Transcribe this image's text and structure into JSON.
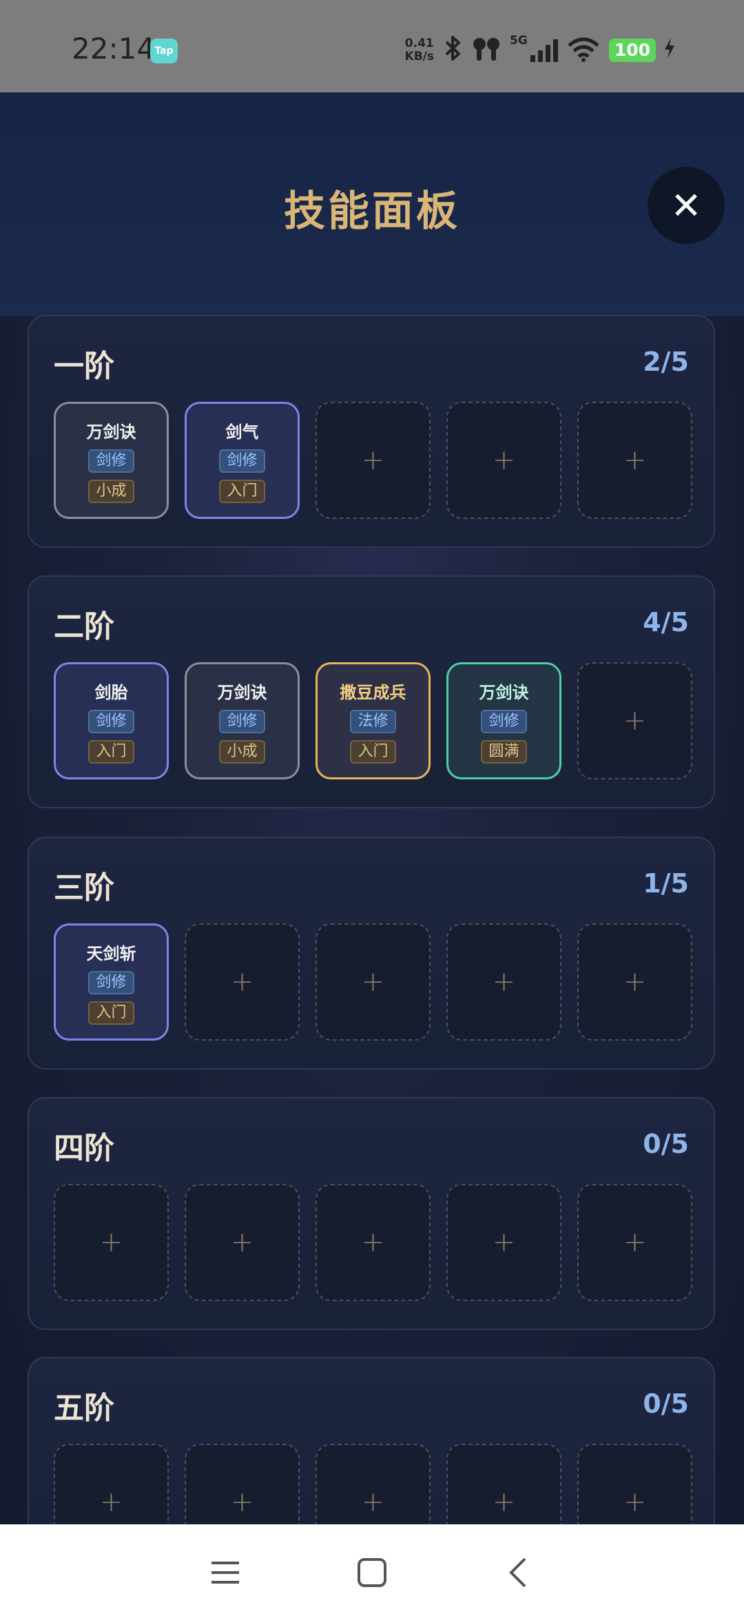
{
  "status_bar": {
    "time": "22:14",
    "tap_label": "Tap",
    "net_speed_value": "0.41",
    "net_speed_unit": "KB/s",
    "signal_type": "5G",
    "battery": "100",
    "icons": [
      "bluetooth-icon",
      "earbuds-icon",
      "signal-icon",
      "wifi-icon",
      "battery-icon",
      "charging-icon"
    ]
  },
  "header": {
    "title": "技能面板",
    "close_glyph": "✕"
  },
  "tiers": [
    {
      "name": "一阶",
      "count": "2/5",
      "slots": [
        {
          "type": "skill",
          "name": "万剑诀",
          "class": "剑修",
          "level": "小成",
          "rarity": "gray"
        },
        {
          "type": "skill",
          "name": "剑气",
          "class": "剑修",
          "level": "入门",
          "rarity": "blue"
        },
        {
          "type": "empty"
        },
        {
          "type": "empty"
        },
        {
          "type": "empty"
        }
      ]
    },
    {
      "name": "二阶",
      "count": "4/5",
      "slots": [
        {
          "type": "skill",
          "name": "剑胎",
          "class": "剑修",
          "level": "入门",
          "rarity": "blue"
        },
        {
          "type": "skill",
          "name": "万剑诀",
          "class": "剑修",
          "level": "小成",
          "rarity": "gray"
        },
        {
          "type": "skill",
          "name": "撒豆成兵",
          "class": "法修",
          "level": "入门",
          "rarity": "gold"
        },
        {
          "type": "skill",
          "name": "万剑诀",
          "class": "剑修",
          "level": "圆满",
          "rarity": "green"
        },
        {
          "type": "empty"
        }
      ]
    },
    {
      "name": "三阶",
      "count": "1/5",
      "slots": [
        {
          "type": "skill",
          "name": "天剑斩",
          "class": "剑修",
          "level": "入门",
          "rarity": "blue"
        },
        {
          "type": "empty"
        },
        {
          "type": "empty"
        },
        {
          "type": "empty"
        },
        {
          "type": "empty"
        }
      ]
    },
    {
      "name": "四阶",
      "count": "0/5",
      "slots": [
        {
          "type": "empty"
        },
        {
          "type": "empty"
        },
        {
          "type": "empty"
        },
        {
          "type": "empty"
        },
        {
          "type": "empty"
        }
      ]
    },
    {
      "name": "五阶",
      "count": "0/5",
      "slots": [
        {
          "type": "empty"
        },
        {
          "type": "empty"
        },
        {
          "type": "empty"
        },
        {
          "type": "empty"
        },
        {
          "type": "empty"
        }
      ]
    }
  ],
  "empty_slot_glyph": "+",
  "nav_bar": {
    "buttons": [
      "menu-icon",
      "home-icon",
      "back-icon"
    ]
  },
  "colors": {
    "title_gold": "#d9b577",
    "count_blue": "#8fb4e8",
    "rarity_blue": "#7f85e8",
    "rarity_gold": "#e7b55e",
    "rarity_green": "#4fd0a4",
    "rarity_gray": "#8c8e9a"
  }
}
